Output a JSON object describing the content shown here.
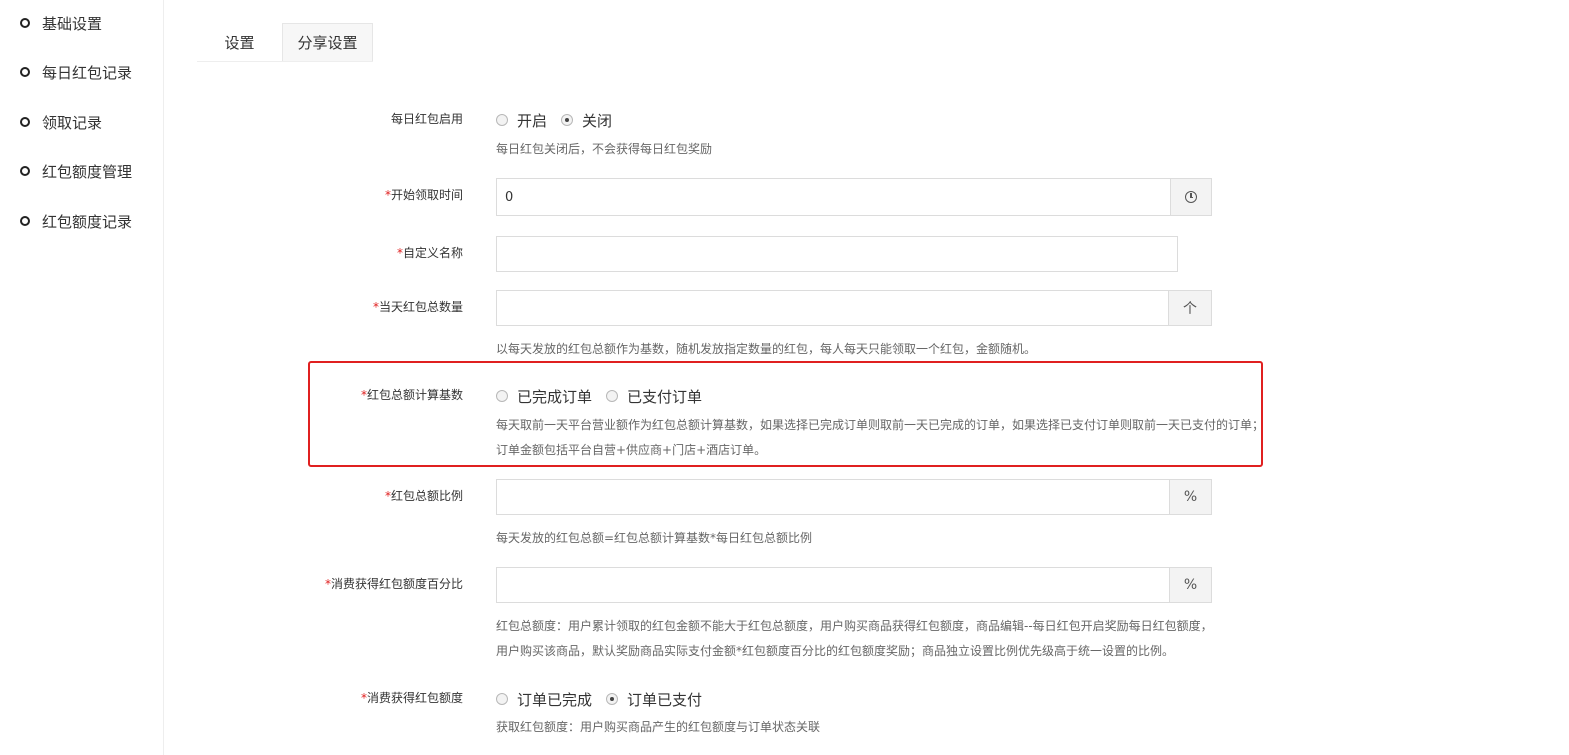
{
  "sidebar": {
    "items": [
      {
        "label": "基础设置"
      },
      {
        "label": "每日红包记录"
      },
      {
        "label": "领取记录"
      },
      {
        "label": "红包额度管理"
      },
      {
        "label": "红包额度记录"
      }
    ]
  },
  "tabs": [
    {
      "label": "设置",
      "active": true
    },
    {
      "label": "分享设置",
      "active": false
    }
  ],
  "form": {
    "enable": {
      "label": "每日红包启用",
      "options": [
        "开启",
        "关闭"
      ],
      "selected": "关闭",
      "help": "每日红包关闭后，不会获得每日红包奖励"
    },
    "start_time": {
      "required_mark": "*",
      "label": "开始领取时间",
      "value": "0",
      "addon_icon": "clock-icon"
    },
    "custom_name": {
      "required_mark": "*",
      "label": "自定义名称",
      "value": ""
    },
    "daily_count": {
      "required_mark": "*",
      "label": "当天红包总数量",
      "value": "",
      "addon": "个",
      "help": "以每天发放的红包总额作为基数，随机发放指定数量的红包，每人每天只能领取一个红包，金额随机。"
    },
    "calc_base": {
      "required_mark": "*",
      "label": "红包总额计算基数",
      "options": [
        "已完成订单",
        "已支付订单"
      ],
      "selected": "",
      "help_line1": "每天取前一天平台营业额作为红包总额计算基数，如果选择已完成订单则取前一天已完成的订单，如果选择已支付订单则取前一天已支付的订单；",
      "help_line2": "订单金额包括平台自营+供应商+门店+酒店订单。"
    },
    "ratio": {
      "required_mark": "*",
      "label": "红包总额比例",
      "value": "",
      "addon": "%",
      "help": "每天发放的红包总额=红包总额计算基数*每日红包总额比例"
    },
    "consume_percent": {
      "required_mark": "*",
      "label": "消费获得红包额度百分比",
      "value": "",
      "addon": "%",
      "help_line1": "红包总额度：用户累计领取的红包金额不能大于红包总额度，用户购买商品获得红包额度，商品编辑--每日红包开启奖励每日红包额度，",
      "help_line2": "用户购买该商品，默认奖励商品实际支付金额*红包额度百分比的红包额度奖励；商品独立设置比例优先级高于统一设置的比例。"
    },
    "consume_quota": {
      "required_mark": "*",
      "label": "消费获得红包额度",
      "options": [
        "订单已完成",
        "订单已支付"
      ],
      "selected": "订单已支付",
      "help": "获取红包额度：用户购买商品产生的红包额度与订单状态关联"
    }
  },
  "colors": {
    "highlight_border": "#e02020",
    "required_mark": "#e02020"
  }
}
